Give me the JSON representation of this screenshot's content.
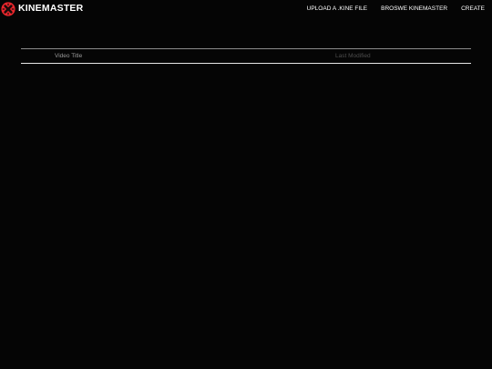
{
  "colors": {
    "background": "#050505",
    "brand_red": "#e8262c",
    "text": "#ffffff",
    "header_text_active": "#9a9a9a",
    "header_text_inactive": "#4e4e4e"
  },
  "header": {
    "logo_icon": "kinemaster-x-icon",
    "brand_name": "KINEMASTER",
    "nav": [
      {
        "label": "UPLOAD A .KINE FILE"
      },
      {
        "label": "BROSWE KINEMASTER"
      },
      {
        "label": "CREATE"
      }
    ]
  },
  "table": {
    "columns": [
      {
        "label": "Video Title"
      },
      {
        "label": "Last Modified"
      }
    ],
    "rows": []
  }
}
